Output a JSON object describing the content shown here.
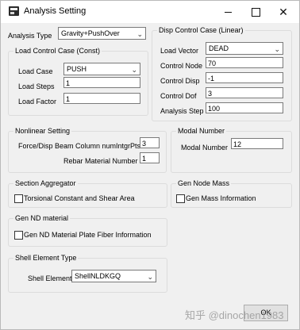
{
  "window": {
    "title": "Analysis Setting",
    "controls": {
      "minimize": "minimize",
      "maximize": "maximize",
      "close": "✕"
    }
  },
  "analysis_type": {
    "label": "Analysis Type",
    "value": "Gravity+PushOver"
  },
  "load_control": {
    "title": "Load Control Case (Const)",
    "load_case": {
      "label": "Load Case",
      "value": "PUSH"
    },
    "load_steps": {
      "label": "Load Steps",
      "value": "1"
    },
    "load_factor": {
      "label": "Load Factor",
      "value": "1"
    }
  },
  "disp_control": {
    "title": "Disp Control Case (Linear)",
    "load_vector": {
      "label": "Load Vector",
      "value": "DEAD"
    },
    "control_node": {
      "label": "Control Node",
      "value": "70"
    },
    "control_disp": {
      "label": "Control Disp",
      "value": "-1"
    },
    "control_dof": {
      "label": "Control Dof",
      "value": "3"
    },
    "analysis_step": {
      "label": "Analysis Step",
      "value": "100"
    }
  },
  "nonlinear": {
    "title": "Nonlinear Setting",
    "int_pts": {
      "label": "Force/Disp Beam Column numIntgrPts",
      "value": "3"
    },
    "rebar_material": {
      "label": "Rebar Material Number",
      "value": "1"
    }
  },
  "modal": {
    "title": "Modal Number",
    "modal_number": {
      "label": "Modal Number",
      "value": "12"
    }
  },
  "section_aggregator": {
    "title": "Section Aggregator",
    "checkbox_label": "Torsional Constant and Shear Area"
  },
  "gen_node_mass": {
    "title": "Gen Node Mass",
    "checkbox_label": "Gen Mass Information"
  },
  "gen_nd_material": {
    "title": "Gen ND material",
    "checkbox_label": "Gen ND Material Plate Fiber Information"
  },
  "shell_type": {
    "title": "Shell Element Type",
    "label": "Shell Element",
    "value": "ShellNLDKGQ"
  },
  "ok_button": {
    "label": "OK"
  },
  "watermark": "知乎 @dinochen1983"
}
